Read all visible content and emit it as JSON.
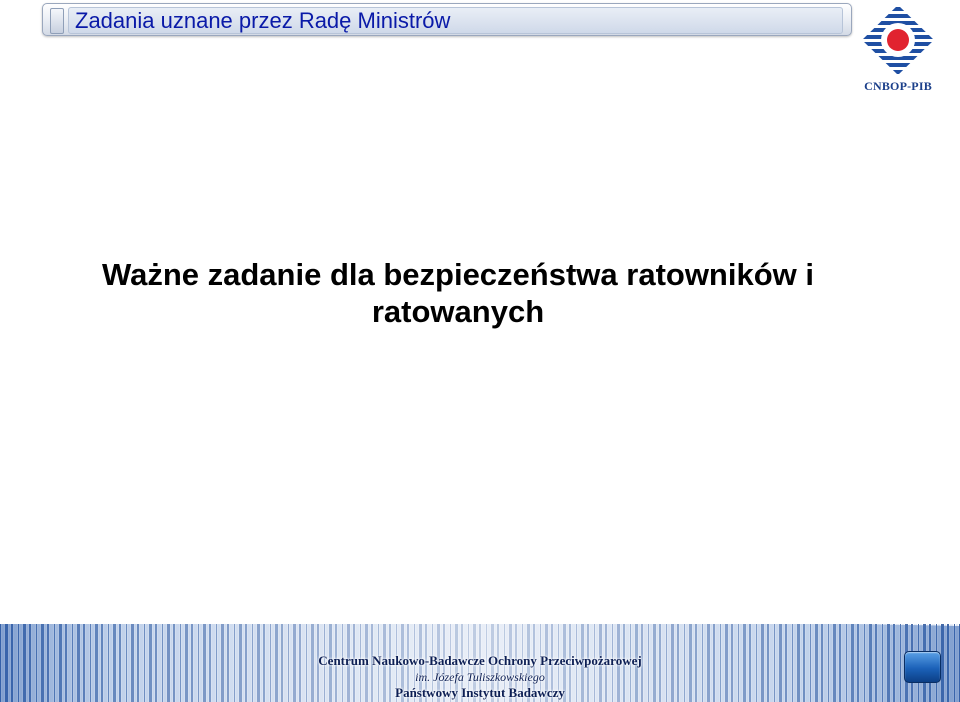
{
  "header": {
    "title": "Zadania uznane przez Radę Ministrów"
  },
  "logo": {
    "name": "CNBOP-PIB",
    "icon": "cnbop-emblem-icon",
    "colors": {
      "blue": "#1f4fa3",
      "red": "#e1232f"
    }
  },
  "main": {
    "heading_line1": "Ważne zadanie dla bezpieczeństwa ratowników i",
    "heading_line2": "ratowanych"
  },
  "footer": {
    "line1": "Centrum Naukowo-Badawcze Ochrony Przeciwpożarowej",
    "line2": "im. Józefa Tuliszkowskiego",
    "line3": "Państwowy Instytut Badawczy",
    "button_icon": "blue-square-button-icon"
  }
}
